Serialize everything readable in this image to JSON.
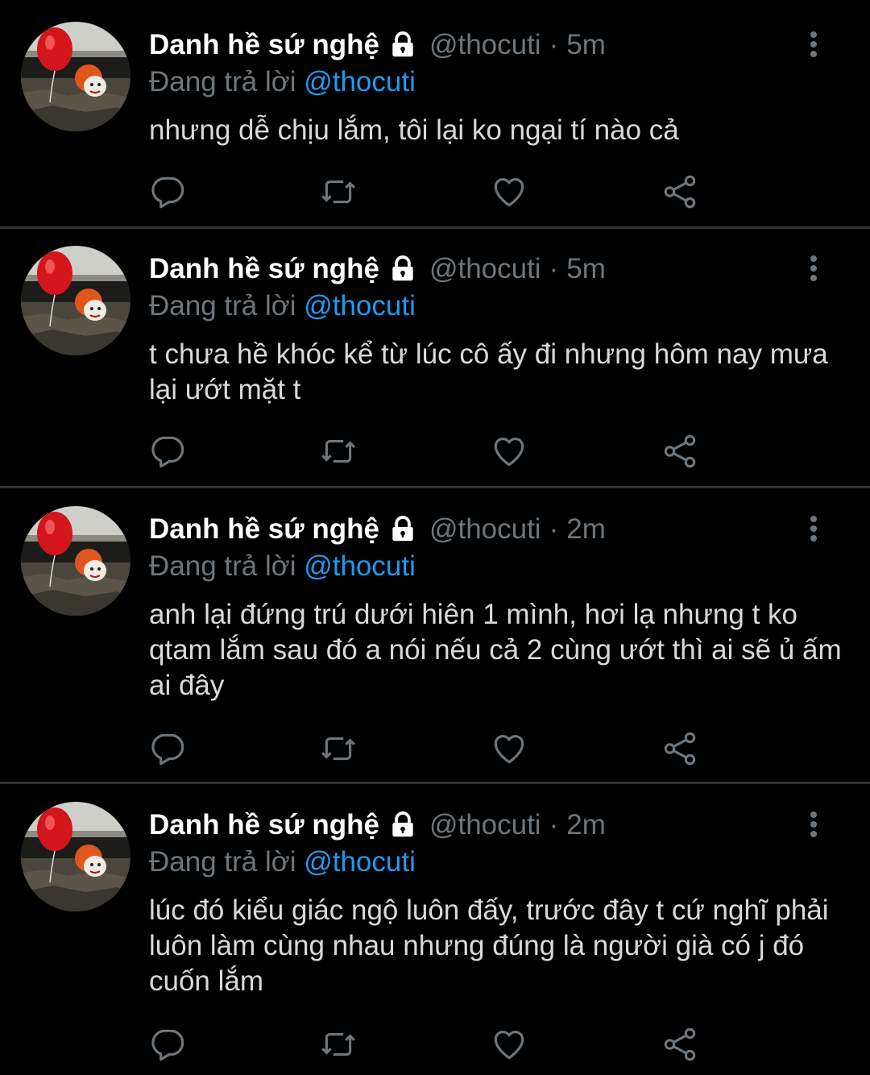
{
  "colors": {
    "background": "#000000",
    "name": "#ffffff",
    "secondary": "#6e767d",
    "mention": "#1d9bf0",
    "text": "#d9d9d9",
    "divider": "#2f3336"
  },
  "tweets": [
    {
      "name": "Danh hề sứ nghệ",
      "handle": "@thocuti",
      "separator": "·",
      "time": "5m",
      "reply_prefix": "Đang trả lời",
      "reply_to": "@thocuti",
      "text": "nhưng dễ chịu lắm, tôi lại ko ngại tí nào cả",
      "icons": [
        "lock-icon",
        "more-icon",
        "reply-icon",
        "retweet-icon",
        "like-icon",
        "share-icon"
      ]
    },
    {
      "name": "Danh hề sứ nghệ",
      "handle": "@thocuti",
      "separator": "·",
      "time": "5m",
      "reply_prefix": "Đang trả lời",
      "reply_to": "@thocuti",
      "text": "t chưa hề khóc kể từ lúc cô ấy đi nhưng hôm nay mưa lại ướt mặt t",
      "icons": [
        "lock-icon",
        "more-icon",
        "reply-icon",
        "retweet-icon",
        "like-icon",
        "share-icon"
      ]
    },
    {
      "name": "Danh hề sứ nghệ",
      "handle": "@thocuti",
      "separator": "·",
      "time": "2m",
      "reply_prefix": "Đang trả lời",
      "reply_to": "@thocuti",
      "text": "anh lại đứng trú dưới hiên 1 mình, hơi lạ nhưng t ko qtam lắm sau đó a nói nếu cả 2 cùng ướt thì ai sẽ ủ ấm ai đây",
      "icons": [
        "lock-icon",
        "more-icon",
        "reply-icon",
        "retweet-icon",
        "like-icon",
        "share-icon"
      ]
    },
    {
      "name": "Danh hề sứ nghệ",
      "handle": "@thocuti",
      "separator": "·",
      "time": "2m",
      "reply_prefix": "Đang trả lời",
      "reply_to": "@thocuti",
      "text": "lúc đó kiểu giác ngộ luôn đấy, trước đây t cứ nghĩ phải luôn làm cùng nhau nhưng đúng là người già có j đó cuốn lắm",
      "icons": [
        "lock-icon",
        "more-icon",
        "reply-icon",
        "retweet-icon",
        "like-icon",
        "share-icon"
      ]
    }
  ]
}
